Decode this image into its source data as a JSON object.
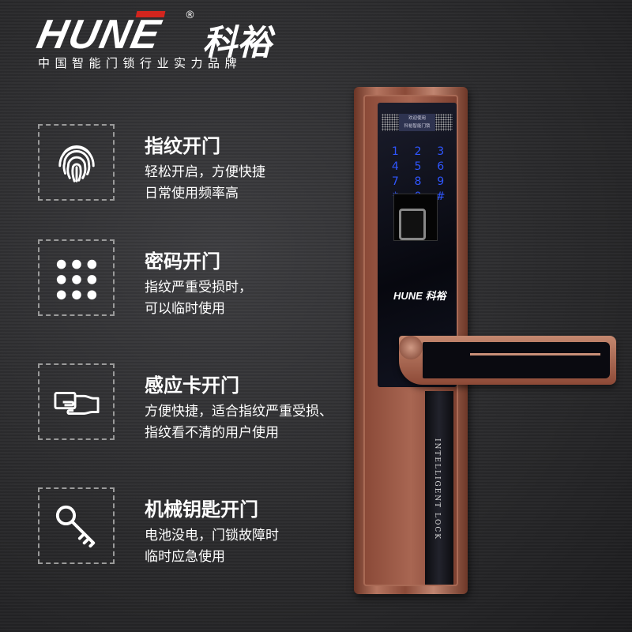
{
  "brand": {
    "name_en": "HUNE",
    "name_cn": "科裕",
    "registered": "®",
    "tagline": "中国智能门锁行业实力品牌",
    "accent": "#d2251e"
  },
  "features": [
    {
      "icon": "fingerprint-icon",
      "title": "指纹开门",
      "lines": [
        "轻松开启，方便快捷",
        "日常使用频率高"
      ]
    },
    {
      "icon": "keypad-icon",
      "title": "密码开门",
      "lines": [
        "指纹严重受损时，",
        "可以临时使用"
      ]
    },
    {
      "icon": "card-icon",
      "title": "感应卡开门",
      "lines": [
        "方便快捷，适合指纹严重受损、",
        "指纹看不清的用户使用"
      ]
    },
    {
      "icon": "key-icon",
      "title": "机械钥匙开门",
      "lines": [
        "电池没电，门锁故障时",
        "临时应急使用"
      ]
    }
  ],
  "lock": {
    "display": [
      "欢迎使用",
      "科裕智能门锁"
    ],
    "keys": [
      "1",
      "2",
      "3",
      "4",
      "5",
      "6",
      "7",
      "8",
      "9",
      "*",
      "0",
      "#"
    ],
    "logo": "HUNE 科裕",
    "strip_text": "INTELLIGENT LOCK",
    "copper": "#a86652",
    "key_color": "#2f56ff"
  }
}
